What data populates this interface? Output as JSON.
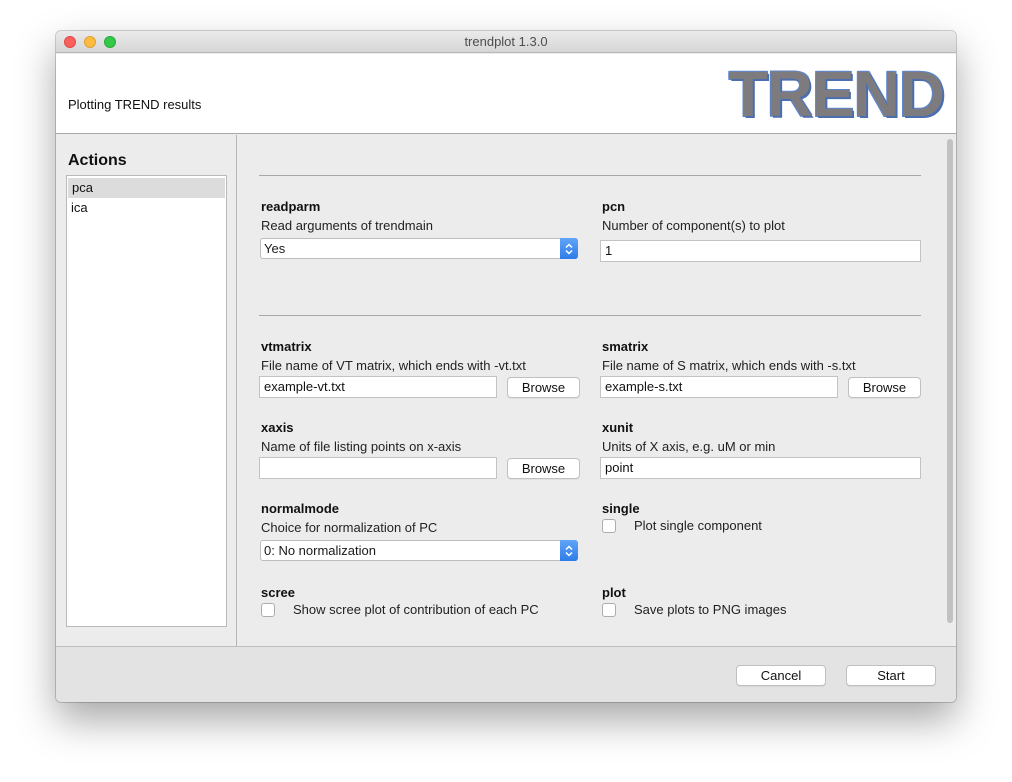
{
  "window": {
    "title": "trendplot 1.3.0"
  },
  "header": {
    "subtitle": "Plotting TREND results",
    "logo_text": "TREND"
  },
  "sidebar": {
    "heading": "Actions",
    "items": [
      {
        "label": "pca",
        "selected": true
      },
      {
        "label": "ica",
        "selected": false
      }
    ]
  },
  "form": {
    "readparm": {
      "label": "readparm",
      "desc": "Read arguments of trendmain",
      "value": "Yes"
    },
    "pcn": {
      "label": "pcn",
      "desc": "Number of component(s) to plot",
      "value": "1"
    },
    "vtmatrix": {
      "label": "vtmatrix",
      "desc": "File name of VT matrix, which ends with -vt.txt",
      "value": "example-vt.txt",
      "browse": "Browse"
    },
    "smatrix": {
      "label": "smatrix",
      "desc": "File name of S matrix, which ends with -s.txt",
      "value": "example-s.txt",
      "browse": "Browse"
    },
    "xaxis": {
      "label": "xaxis",
      "desc": "Name of file listing points on x-axis",
      "value": "",
      "browse": "Browse"
    },
    "xunit": {
      "label": "xunit",
      "desc": "Units of X axis, e.g. uM or min",
      "value": "point"
    },
    "normalmode": {
      "label": "normalmode",
      "desc": "Choice for normalization of PC",
      "value": "0: No normalization"
    },
    "single": {
      "label": "single",
      "checkbox_label": "Plot single component",
      "checked": false
    },
    "scree": {
      "label": "scree",
      "checkbox_label": "Show scree plot of contribution of each PC",
      "checked": false
    },
    "plot": {
      "label": "plot",
      "checkbox_label": "Save plots to PNG images",
      "checked": false
    }
  },
  "footer": {
    "cancel": "Cancel",
    "start": "Start"
  },
  "colors": {
    "accent": "#2f7cea",
    "close": "#fc605c",
    "minimize": "#fdbc40",
    "maximize": "#34c84a"
  },
  "icons": {
    "select_arrow": "chevron-updown-icon"
  }
}
